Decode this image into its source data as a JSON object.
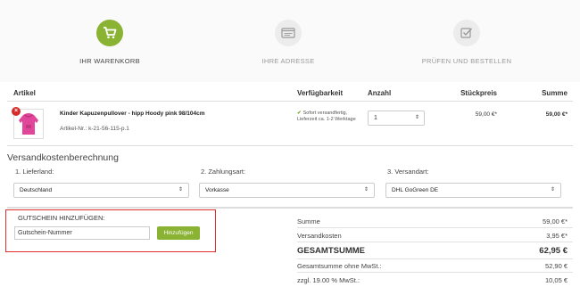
{
  "steps": [
    {
      "label": "IHR WARENKORB",
      "icon": "cart-icon",
      "active": true
    },
    {
      "label": "IHRE ADRESSE",
      "icon": "address-card-icon",
      "active": false
    },
    {
      "label": "PRÜFEN UND BESTELLEN",
      "icon": "checkbox-icon",
      "active": false
    }
  ],
  "table": {
    "headers": {
      "article": "Artikel",
      "availability": "Verfügbarkeit",
      "quantity": "Anzahl",
      "unit_price": "Stückpreis",
      "total": "Summe"
    }
  },
  "item": {
    "name": "Kinder Kapuzenpullover - hipp Hoody pink 98/104cm",
    "article_number": "Artikel-Nr.: k-21-56-115-p.1",
    "availability_line1": "Sofort versandfertig,",
    "availability_line2": "Lieferzeit ca. 1-2 Werktage",
    "quantity": "1",
    "unit_price": "59,00 €*",
    "total": "59,00 €*",
    "remove_symbol": "×"
  },
  "shipping": {
    "title": "Versandkostenberechnung",
    "country_label": "1. Lieferland:",
    "country_value": "Deutschland",
    "payment_label": "2. Zahlungsart:",
    "payment_value": "Vorkasse",
    "method_label": "3. Versandart:",
    "method_value": "DHL GoGreen DE"
  },
  "coupon": {
    "label": "GUTSCHEIN HINZUFÜGEN:",
    "placeholder": "Gutschein-Nummer",
    "button": "Hinzufügen"
  },
  "summary": {
    "subtotal_label": "Summe",
    "subtotal_value": "59,00 €*",
    "shipping_label": "Versandkosten",
    "shipping_value": "3,95 €*",
    "total_label": "GESAMTSUMME",
    "total_value": "62,95 €",
    "net_label": "Gesamtsumme ohne MwSt.:",
    "net_value": "52,90 €",
    "vat_label": "zzgl. 19.00 % MwSt.:",
    "vat_value": "10,05 €"
  },
  "colors": {
    "accent": "#8ab233",
    "highlight_border": "#e03030",
    "remove": "#d62b2b"
  }
}
